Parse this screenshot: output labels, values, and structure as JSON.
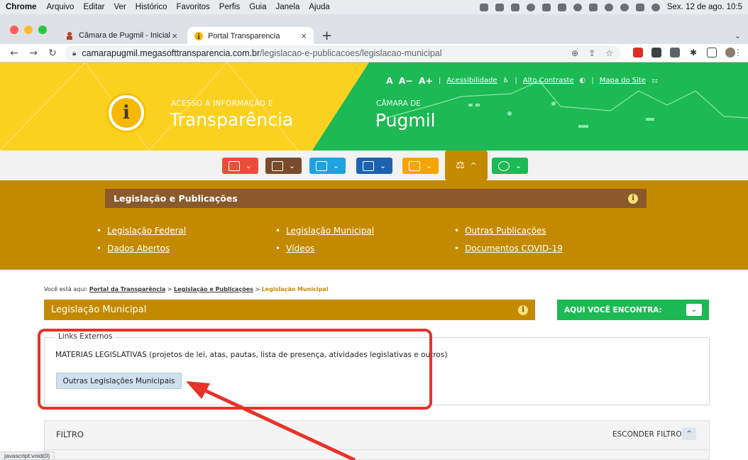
{
  "menubar": {
    "app": "Chrome",
    "items": [
      "Arquivo",
      "Editar",
      "Ver",
      "Histórico",
      "Favoritos",
      "Perfis",
      "Guia",
      "Janela",
      "Ajuda"
    ],
    "clock": "Sex. 12 de ago. 10:5"
  },
  "tabs": [
    {
      "title": "Câmara de Pugmil - Inicial",
      "close": "×"
    },
    {
      "title": "Portal Transparencia",
      "close": "×"
    }
  ],
  "newtab": "+",
  "tabmenu": "⌄",
  "address": {
    "host": "camarapugmil.megasofttransparencia.com.br",
    "path": "/legislacao-e-publicacoes/legislacao-municipal"
  },
  "header": {
    "brand_top": "ACESSO A INFORMAÇÃO E",
    "brand_main": "Transparência",
    "camara_top": "CÂMARA DE",
    "camara_main": "Pugmil",
    "font_small": "A",
    "font_minus": "A−",
    "font_plus": "A+",
    "acessibilidade": "Acessibilidade",
    "alto_contraste": "Alto Contraste",
    "mapa": "Mapa do Site",
    "logo_letter": "i"
  },
  "iconnav": [
    {
      "color": "#e94e3c"
    },
    {
      "color": "#7a4b2a"
    },
    {
      "color": "#1fa2e0"
    },
    {
      "color": "#1c62b0"
    },
    {
      "color": "#f6a500"
    },
    {
      "color": "#c38a00",
      "active": true
    },
    {
      "color": "#1db954"
    }
  ],
  "section": {
    "title": "Legislação e Publicações",
    "info": "i",
    "links": [
      "Legislação Federal",
      "Legislação Municipal",
      "Outras Publicações",
      "Dados Abertos",
      "Vídeos",
      "Documentos COVID-19"
    ]
  },
  "breadcrumb": {
    "prefix": "Você está aqui:",
    "home": "Portal da Transparência",
    "sep": ">",
    "parent": "Legislação e Publicações",
    "current": "Legislação Municipal"
  },
  "page": {
    "title": "Legislação Municipal",
    "info": "i",
    "aqui": "AQUI VOCÊ ENCONTRA:",
    "aqui_toggle": "⌄"
  },
  "links_externos": {
    "legend": "Links Externos",
    "text": "MATERIAS LEGISLATIVAS (projetos de lei, atas, pautas, lista de presença, atividades legislativas e outros)",
    "button": "Outras Legislações Municipais"
  },
  "filtro": {
    "title": "FILTRO",
    "hide": "ESCONDER FILTRO",
    "toggle": "^"
  },
  "statusbar": "javascript:void(0)",
  "colors": {
    "gold": "#c38a00",
    "yellow": "#fbd120",
    "green": "#1db954",
    "brown": "#8a5a2b",
    "annotation": "#e8322a"
  }
}
